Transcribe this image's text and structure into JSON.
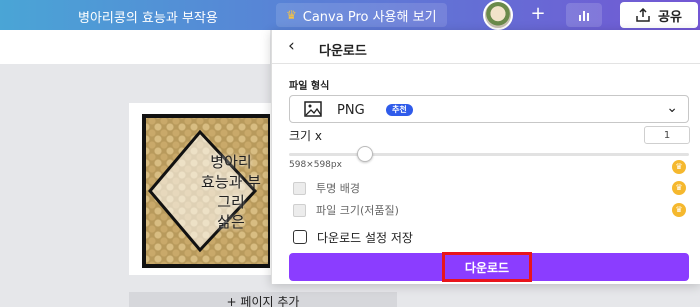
{
  "topbar": {
    "doc_title": "병아리콩의 효능과 부작용",
    "pro_label": "Canva Pro 사용해 보기",
    "plus_icon": "+",
    "share_label": "공유",
    "brand_gradient": [
      "#4aa5d6",
      "#7357d4"
    ]
  },
  "canvas": {
    "overlay_lines": [
      "병아리",
      "효능과 부",
      "그리",
      "삶은"
    ],
    "add_page_label": "+ 페이지 추가"
  },
  "panel": {
    "title": "다운로드",
    "file_type_label": "파일 형식",
    "format_value": "PNG",
    "recommended_badge": "추천",
    "size_label": "크기 x",
    "size_value": "1",
    "size_fraction": 0.19,
    "dimensions": "598×598px",
    "options": [
      {
        "label": "투명 배경",
        "checked": false,
        "pro": true
      },
      {
        "label": "파일 크기(저품질)",
        "checked": false,
        "pro": true
      }
    ],
    "save_settings_label": "다운로드 설정 저장",
    "download_label": "다운로드",
    "accent_color": "#8b3dff",
    "highlight_color": "#e8151b"
  }
}
